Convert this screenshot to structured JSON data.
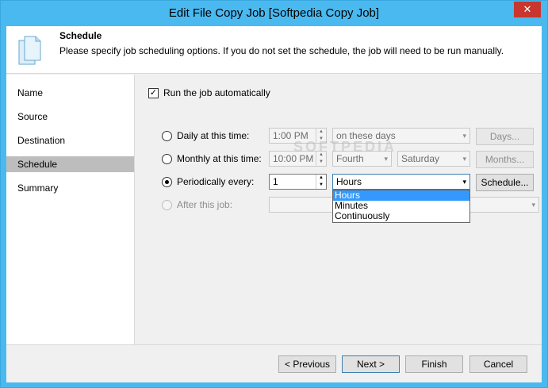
{
  "window": {
    "title": "Edit File Copy Job [Softpedia  Copy Job]",
    "close_label": "✕",
    "accent": "#4ab9f0"
  },
  "header": {
    "title": "Schedule",
    "description": "Please specify job scheduling options. If you do not set the schedule, the job will need to be run manually."
  },
  "sidebar": {
    "items": [
      {
        "label": "Name"
      },
      {
        "label": "Source"
      },
      {
        "label": "Destination"
      },
      {
        "label": "Schedule"
      },
      {
        "label": "Summary"
      }
    ],
    "selected": "Schedule"
  },
  "schedule": {
    "run_automatically": {
      "label": "Run the job automatically",
      "checked": true,
      "mark": "✓"
    },
    "daily": {
      "label": "Daily at this time:",
      "time": "1:00 PM",
      "days_mode": "on these days",
      "button": "Days..."
    },
    "monthly": {
      "label": "Monthly at this time:",
      "time": "10:00 PM",
      "week": "Fourth",
      "weekday": "Saturday",
      "button": "Months..."
    },
    "periodic": {
      "label": "Periodically every:",
      "value": "1",
      "unit": "Hours",
      "button": "Schedule...",
      "options": [
        "Hours",
        "Minutes",
        "Continuously"
      ]
    },
    "after_job": {
      "label": "After this job:",
      "value": ""
    }
  },
  "watermark": "SOFTPEDIA",
  "footer": {
    "previous": "< Previous",
    "next": "Next >",
    "finish": "Finish",
    "cancel": "Cancel"
  }
}
